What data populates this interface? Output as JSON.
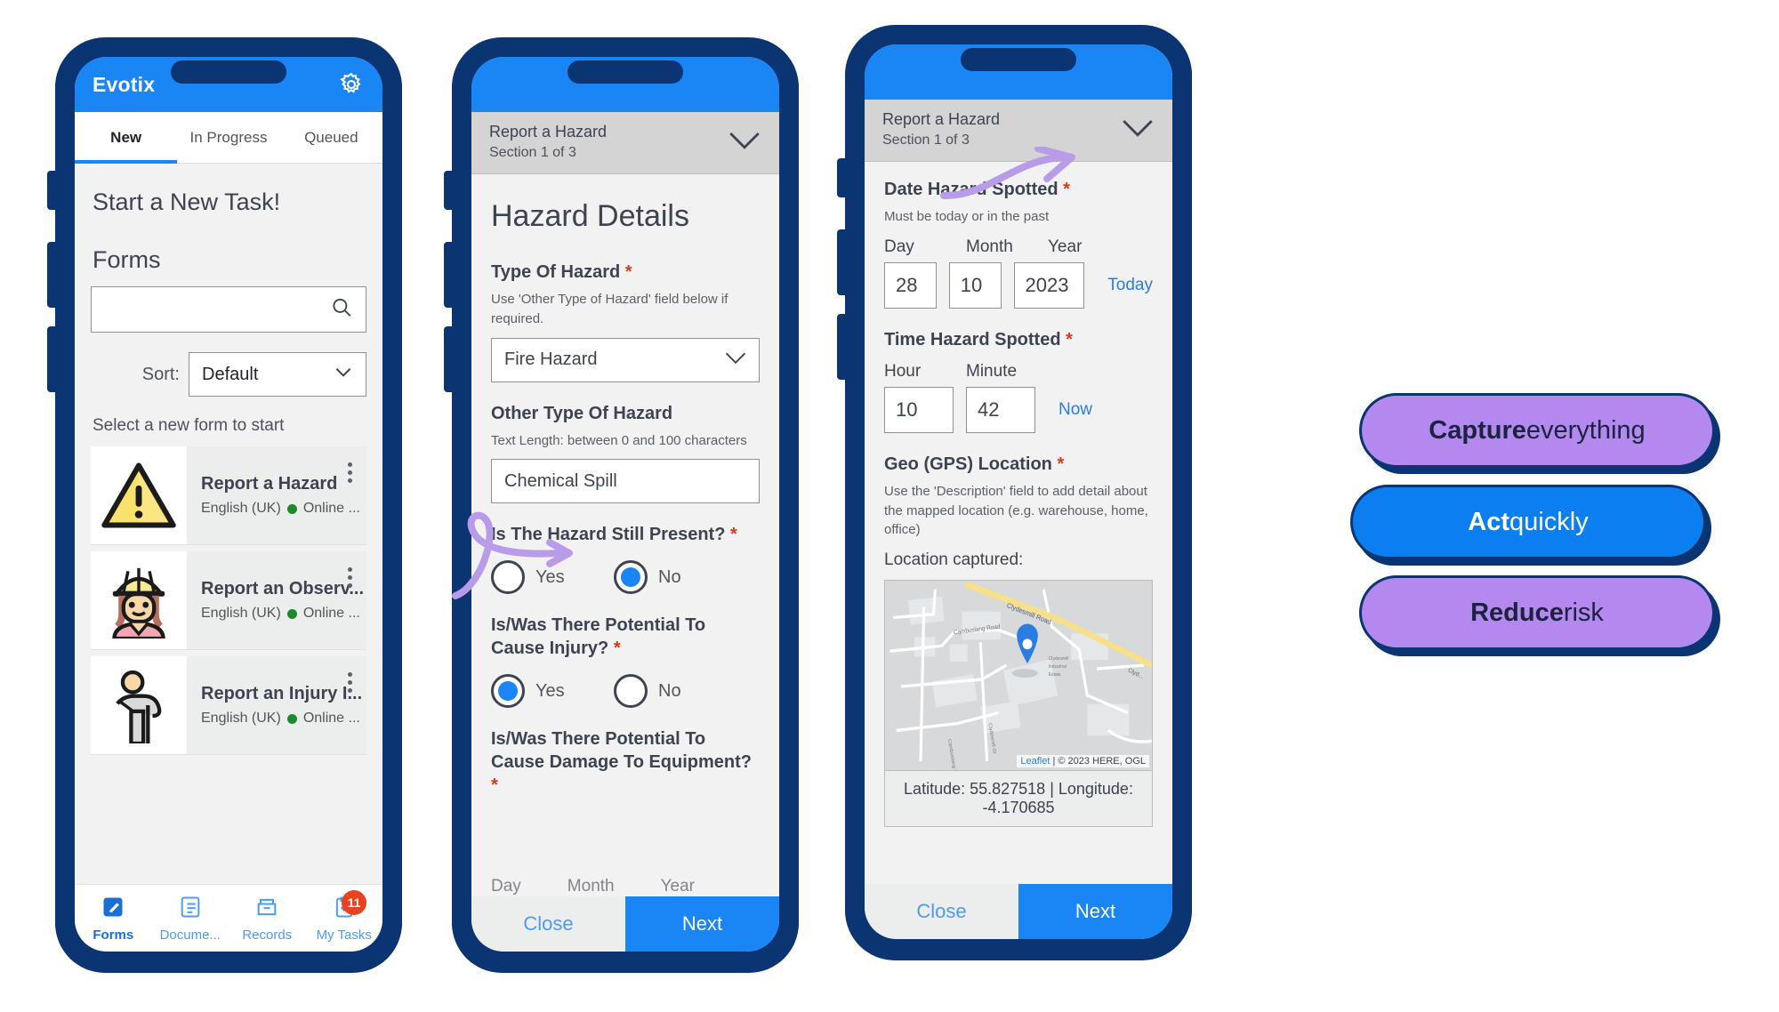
{
  "phone1": {
    "brand": "Evotix",
    "gear_icon": "gear-icon",
    "tabs": [
      {
        "label": "New",
        "active": true
      },
      {
        "label": "In Progress",
        "active": false
      },
      {
        "label": "Queued",
        "active": false
      }
    ],
    "heading": "Start a New Task!",
    "forms_heading": "Forms",
    "search": {
      "value": "",
      "placeholder": "",
      "icon": "search-icon"
    },
    "sort": {
      "label": "Sort:",
      "value": "Default",
      "icon": "chevron-down-icon"
    },
    "hint": "Select a new form to start",
    "form_list": [
      {
        "title": "Report a Hazard",
        "language": "English (UK)",
        "status": "Online ...",
        "icon": "warning-triangle-icon"
      },
      {
        "title": "Report an Observ...",
        "language": "English (UK)",
        "status": "Online ...",
        "icon": "worker-woman-icon"
      },
      {
        "title": "Report an Injury I...",
        "language": "English (UK)",
        "status": "Online ...",
        "icon": "injured-person-icon"
      }
    ],
    "bottom_nav": [
      {
        "label": "Forms",
        "icon": "form-edit-icon",
        "active": true,
        "badge": ""
      },
      {
        "label": "Docume...",
        "icon": "document-icon",
        "active": false,
        "badge": ""
      },
      {
        "label": "Records",
        "icon": "file-box-icon",
        "active": false,
        "badge": ""
      },
      {
        "label": "My Tasks",
        "icon": "clipboard-check-icon",
        "active": false,
        "badge": "11"
      }
    ]
  },
  "phone2": {
    "section_header": {
      "title": "Report a Hazard",
      "subtitle": "Section 1 of 3",
      "icon": "chevron-down-icon"
    },
    "page_title": "Hazard Details",
    "fields": {
      "type_of_hazard": {
        "label": "Type Of Hazard",
        "required": "*",
        "help": "Use 'Other Type of Hazard' field below if required.",
        "value": "Fire Hazard",
        "icon": "chevron-down-icon"
      },
      "other_type_of_hazard": {
        "label": "Other Type Of Hazard",
        "help": "Text Length: between 0 and 100 characters",
        "value": "Chemical Spill"
      },
      "hazard_still_present": {
        "label": "Is The Hazard Still Present?",
        "required": "*",
        "options": [
          {
            "label": "Yes",
            "selected": false
          },
          {
            "label": "No",
            "selected": true
          }
        ]
      },
      "potential_injury": {
        "label": "Is/Was There Potential To Cause Injury?",
        "required": "*",
        "options": [
          {
            "label": "Yes",
            "selected": true
          },
          {
            "label": "No",
            "selected": false
          }
        ]
      },
      "potential_damage": {
        "label": "Is/Was There Potential To Cause Damage To Equipment?",
        "required": "*"
      }
    },
    "ghost_labels": [
      "Day",
      "Month",
      "Year"
    ],
    "footer": {
      "close": "Close",
      "next": "Next"
    }
  },
  "phone3": {
    "section_header": {
      "title": "Report a Hazard",
      "subtitle": "Section 1 of 3",
      "icon": "chevron-down-icon"
    },
    "fields": {
      "date_spotted": {
        "label": "Date Hazard Spotted",
        "required": "*",
        "help": "Must be today or in the past",
        "day_label": "Day",
        "month_label": "Month",
        "year_label": "Year",
        "day": "28",
        "month": "10",
        "year": "2023",
        "action": "Today"
      },
      "time_spotted": {
        "label": "Time Hazard Spotted",
        "required": "*",
        "hour_label": "Hour",
        "minute_label": "Minute",
        "hour": "10",
        "minute": "42",
        "action": "Now"
      },
      "geo_location": {
        "label": "Geo (GPS) Location",
        "required": "*",
        "help": "Use the 'Description' field to add detail about the mapped location (e.g. warehouse, home, office)",
        "captured_label": "Location captured:",
        "map": {
          "pin_icon": "map-pin-icon",
          "roads": [
            "Clydesmill Road",
            "Cambuslang Road",
            "Cambuslang Rd",
            "Clydesmill Gr",
            "Clyd...",
            "Clydesmill Road"
          ],
          "place": "Clydesmill Industrial Estate",
          "attribution_link": "Leaflet",
          "attribution": "| © 2023 HERE, OGL"
        },
        "coordinates": "Latitude: 55.827518 | Longitude: -4.170685"
      }
    },
    "footer": {
      "close": "Close",
      "next": "Next"
    }
  },
  "callouts": [
    {
      "strong": "Capture",
      "rest": " everything",
      "color": "#b388ef"
    },
    {
      "strong": "Act",
      "rest": " quickly",
      "color": "#0b7ff0"
    },
    {
      "strong": "Reduce",
      "rest": " risk",
      "color": "#b388ef"
    }
  ],
  "colors": {
    "phone_frame": "#0b3473",
    "accent_blue": "#1a85f5",
    "purple": "#b388ef",
    "badge_red": "#e8421f",
    "required_red": "#d93a1a",
    "online_green": "#1d8a2b",
    "arrow_purple": "#b89ce8"
  }
}
